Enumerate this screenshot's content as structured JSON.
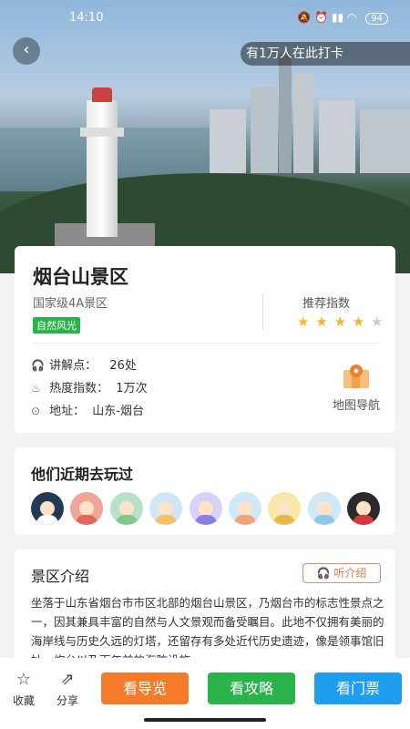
{
  "status_bar": {
    "time": "14:10",
    "battery": "94"
  },
  "hero": {
    "checkin_text": "有1万人在此打卡"
  },
  "info": {
    "title": "烟台山景区",
    "level": "国家级4A景区",
    "tag": "自然风光",
    "rec_label": "推荐指数",
    "rating": 4,
    "rating_max": 5,
    "rows": [
      {
        "icon": "headphone-icon",
        "label": "讲解点：",
        "value": "26处"
      },
      {
        "icon": "hot-icon",
        "label": "热度指数：",
        "value": "1万次"
      },
      {
        "icon": "location-icon",
        "label": "地址：",
        "value": "山东-烟台"
      }
    ],
    "map_nav_label": "地图导航"
  },
  "visitors": {
    "title": "他们近期去玩过"
  },
  "intro": {
    "title": "景区介绍",
    "listen_label": "听介绍",
    "text": "坐落于山东省烟台市市区北部的烟台山景区，乃烟台市的标志性景点之一，因其兼具丰富的自然与人文景观而备受瞩目。此地不仅拥有美丽的海岸线与历史久远的灯塔，还留存有多处近代历史遗迹，像是领事馆旧址、炮台以及百年前的海防设施"
  },
  "bottom": {
    "collect_label": "收藏",
    "share_label": "分享",
    "guide_label": "看导览",
    "strategy_label": "看攻略",
    "ticket_label": "看门票"
  },
  "colors": {
    "guide": "#f47b2a",
    "strategy": "#2bb34b",
    "ticket": "#1f9ef0",
    "accent": "#e5744f"
  }
}
